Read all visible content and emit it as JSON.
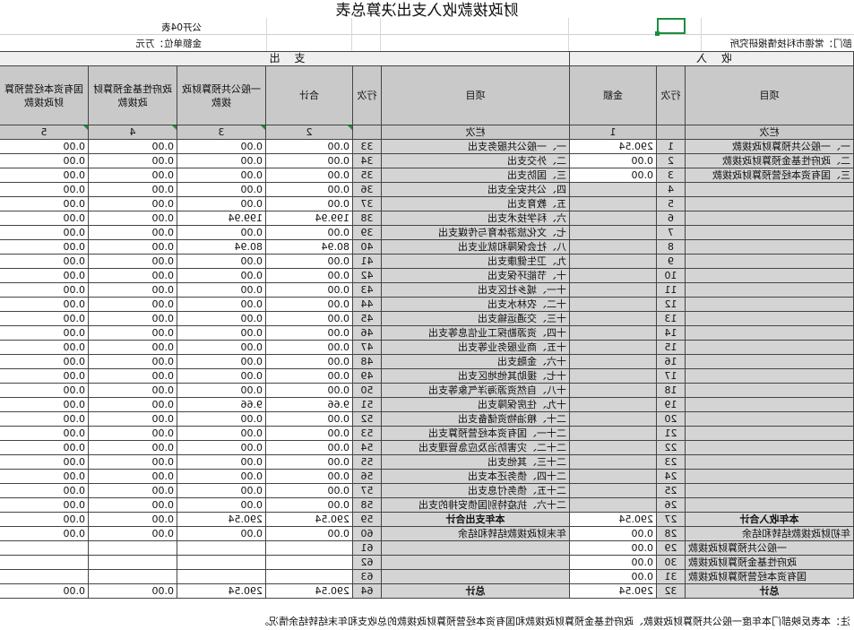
{
  "title": "财政拨款收入支出决算总表",
  "form_no": "公开04表",
  "unit_label": "金额单位：万元",
  "dept_label": "部门：常德市科技情报研究所",
  "section": {
    "income": "收  入",
    "expense": "支  出"
  },
  "headers": {
    "item": "项目",
    "row": "行次",
    "amount": "金额",
    "total": "合计",
    "general": "一般公共预算财政拨款",
    "gov_fund": "政府性基金预算财政拨款",
    "state_capital": "国有资本经营预算财政拨款",
    "col_label": "栏次",
    "col1": "1",
    "col2": "2",
    "col3": "3",
    "col4": "4",
    "col5": "5"
  },
  "rows": [
    {
      "ii": "一、一般公共预算财政拨款",
      "ir": "1",
      "ia": "290.54",
      "ei": "一、一般公共服务支出",
      "er": "33",
      "t": "0.00",
      "g": "0.00",
      "f": "0.00",
      "s": "0.00"
    },
    {
      "ii": "二、政府性基金预算财政拨款",
      "ir": "2",
      "ia": "0.00",
      "ei": "二、外交支出",
      "er": "34",
      "t": "0.00",
      "g": "0.00",
      "f": "0.00",
      "s": "0.00"
    },
    {
      "ii": "三、国有资本经营预算财政拨款",
      "ir": "3",
      "ia": "0.00",
      "ei": "三、国防支出",
      "er": "35",
      "t": "0.00",
      "g": "0.00",
      "f": "0.00",
      "s": "0.00"
    },
    {
      "ii": "",
      "ir": "4",
      "ia": "",
      "ei": "四、公共安全支出",
      "er": "36",
      "t": "0.00",
      "g": "0.00",
      "f": "0.00",
      "s": "0.00"
    },
    {
      "ii": "",
      "ir": "5",
      "ia": "",
      "ei": "五、教育支出",
      "er": "37",
      "t": "0.00",
      "g": "0.00",
      "f": "0.00",
      "s": "0.00"
    },
    {
      "ii": "",
      "ir": "6",
      "ia": "",
      "ei": "六、科学技术支出",
      "er": "38",
      "t": "199.94",
      "g": "199.94",
      "f": "0.00",
      "s": "0.00"
    },
    {
      "ii": "",
      "ir": "7",
      "ia": "",
      "ei": "七、文化旅游体育与传媒支出",
      "er": "39",
      "t": "0.00",
      "g": "0.00",
      "f": "0.00",
      "s": "0.00"
    },
    {
      "ii": "",
      "ir": "8",
      "ia": "",
      "ei": "八、社会保障和就业支出",
      "er": "40",
      "t": "80.94",
      "g": "80.94",
      "f": "0.00",
      "s": "0.00"
    },
    {
      "ii": "",
      "ir": "9",
      "ia": "",
      "ei": "九、卫生健康支出",
      "er": "41",
      "t": "0.00",
      "g": "0.00",
      "f": "0.00",
      "s": "0.00"
    },
    {
      "ii": "",
      "ir": "10",
      "ia": "",
      "ei": "十、节能环保支出",
      "er": "42",
      "t": "0.00",
      "g": "0.00",
      "f": "0.00",
      "s": "0.00"
    },
    {
      "ii": "",
      "ir": "11",
      "ia": "",
      "ei": "十一、城乡社区支出",
      "er": "43",
      "t": "0.00",
      "g": "0.00",
      "f": "0.00",
      "s": "0.00"
    },
    {
      "ii": "",
      "ir": "12",
      "ia": "",
      "ei": "十二、农林水支出",
      "er": "44",
      "t": "0.00",
      "g": "0.00",
      "f": "0.00",
      "s": "0.00"
    },
    {
      "ii": "",
      "ir": "13",
      "ia": "",
      "ei": "十三、交通运输支出",
      "er": "45",
      "t": "0.00",
      "g": "0.00",
      "f": "0.00",
      "s": "0.00"
    },
    {
      "ii": "",
      "ir": "14",
      "ia": "",
      "ei": "十四、资源勘探工业信息等支出",
      "er": "46",
      "t": "0.00",
      "g": "0.00",
      "f": "0.00",
      "s": "0.00"
    },
    {
      "ii": "",
      "ir": "15",
      "ia": "",
      "ei": "十五、商业服务业等支出",
      "er": "47",
      "t": "0.00",
      "g": "0.00",
      "f": "0.00",
      "s": "0.00"
    },
    {
      "ii": "",
      "ir": "16",
      "ia": "",
      "ei": "十六、金融支出",
      "er": "48",
      "t": "0.00",
      "g": "0.00",
      "f": "0.00",
      "s": "0.00"
    },
    {
      "ii": "",
      "ir": "17",
      "ia": "",
      "ei": "十七、援助其他地区支出",
      "er": "49",
      "t": "0.00",
      "g": "0.00",
      "f": "0.00",
      "s": "0.00"
    },
    {
      "ii": "",
      "ir": "18",
      "ia": "",
      "ei": "十八、自然资源海洋气象等支出",
      "er": "50",
      "t": "0.00",
      "g": "0.00",
      "f": "0.00",
      "s": "0.00"
    },
    {
      "ii": "",
      "ir": "19",
      "ia": "",
      "ei": "十九、住房保障支出",
      "er": "51",
      "t": "9.66",
      "g": "9.66",
      "f": "0.00",
      "s": "0.00"
    },
    {
      "ii": "",
      "ir": "20",
      "ia": "",
      "ei": "二十、粮油物资储备支出",
      "er": "52",
      "t": "0.00",
      "g": "0.00",
      "f": "0.00",
      "s": "0.00"
    },
    {
      "ii": "",
      "ir": "21",
      "ia": "",
      "ei": "二十一、国有资本经营预算支出",
      "er": "53",
      "t": "0.00",
      "g": "0.00",
      "f": "0.00",
      "s": "0.00"
    },
    {
      "ii": "",
      "ir": "22",
      "ia": "",
      "ei": "二十二、灾害防治及应急管理支出",
      "er": "54",
      "t": "0.00",
      "g": "0.00",
      "f": "0.00",
      "s": "0.00"
    },
    {
      "ii": "",
      "ir": "23",
      "ia": "",
      "ei": "二十三、其他支出",
      "er": "55",
      "t": "0.00",
      "g": "0.00",
      "f": "0.00",
      "s": "0.00"
    },
    {
      "ii": "",
      "ir": "24",
      "ia": "",
      "ei": "二十四、债务还本支出",
      "er": "56",
      "t": "0.00",
      "g": "0.00",
      "f": "0.00",
      "s": "0.00"
    },
    {
      "ii": "",
      "ir": "25",
      "ia": "",
      "ei": "二十五、债务付息支出",
      "er": "57",
      "t": "0.00",
      "g": "0.00",
      "f": "0.00",
      "s": "0.00"
    },
    {
      "ii": "",
      "ir": "26",
      "ia": "",
      "ei": "二十六、抗疫特别国债安排的支出",
      "er": "58",
      "t": "0.00",
      "g": "0.00",
      "f": "0.00",
      "s": "0.00"
    },
    {
      "ii": "本年收入合计",
      "ir": "27",
      "ia": "290.54",
      "ei": "本年支出合计",
      "er": "59",
      "t": "290.54",
      "g": "290.54",
      "f": "0.00",
      "s": "0.00",
      "bold": true
    },
    {
      "ii": "年初财政拨款结转和结余",
      "ir": "28",
      "ia": "0.00",
      "ei": "年末财政拨款结转和结余",
      "er": "60",
      "t": "0.00",
      "g": "0.00",
      "f": "0.00",
      "s": "0.00"
    },
    {
      "ii": "一般公共预算财政拨款",
      "ir": "29",
      "ia": "0.00",
      "ei": "",
      "er": "61",
      "t": "",
      "g": "",
      "f": "",
      "s": ""
    },
    {
      "ii": "政府性基金预算财政拨款",
      "ir": "30",
      "ia": "0.00",
      "ei": "",
      "er": "62",
      "t": "",
      "g": "",
      "f": "",
      "s": ""
    },
    {
      "ii": "国有资本经营预算财政拨款",
      "ir": "31",
      "ia": "0.00",
      "ei": "",
      "er": "63",
      "t": "",
      "g": "",
      "f": "",
      "s": ""
    },
    {
      "ii": "总计",
      "ir": "32",
      "ia": "290.54",
      "ei": "总计",
      "er": "64",
      "t": "290.54",
      "g": "290.54",
      "f": "0.00",
      "s": "0.00",
      "bold": true
    }
  ],
  "note": "注：本表反映部门本年度一般公共预算财政拨款、政府性基金预算财政拨款和国有资本经营预算财政拨款的总收支和年末结转结余情况。"
}
